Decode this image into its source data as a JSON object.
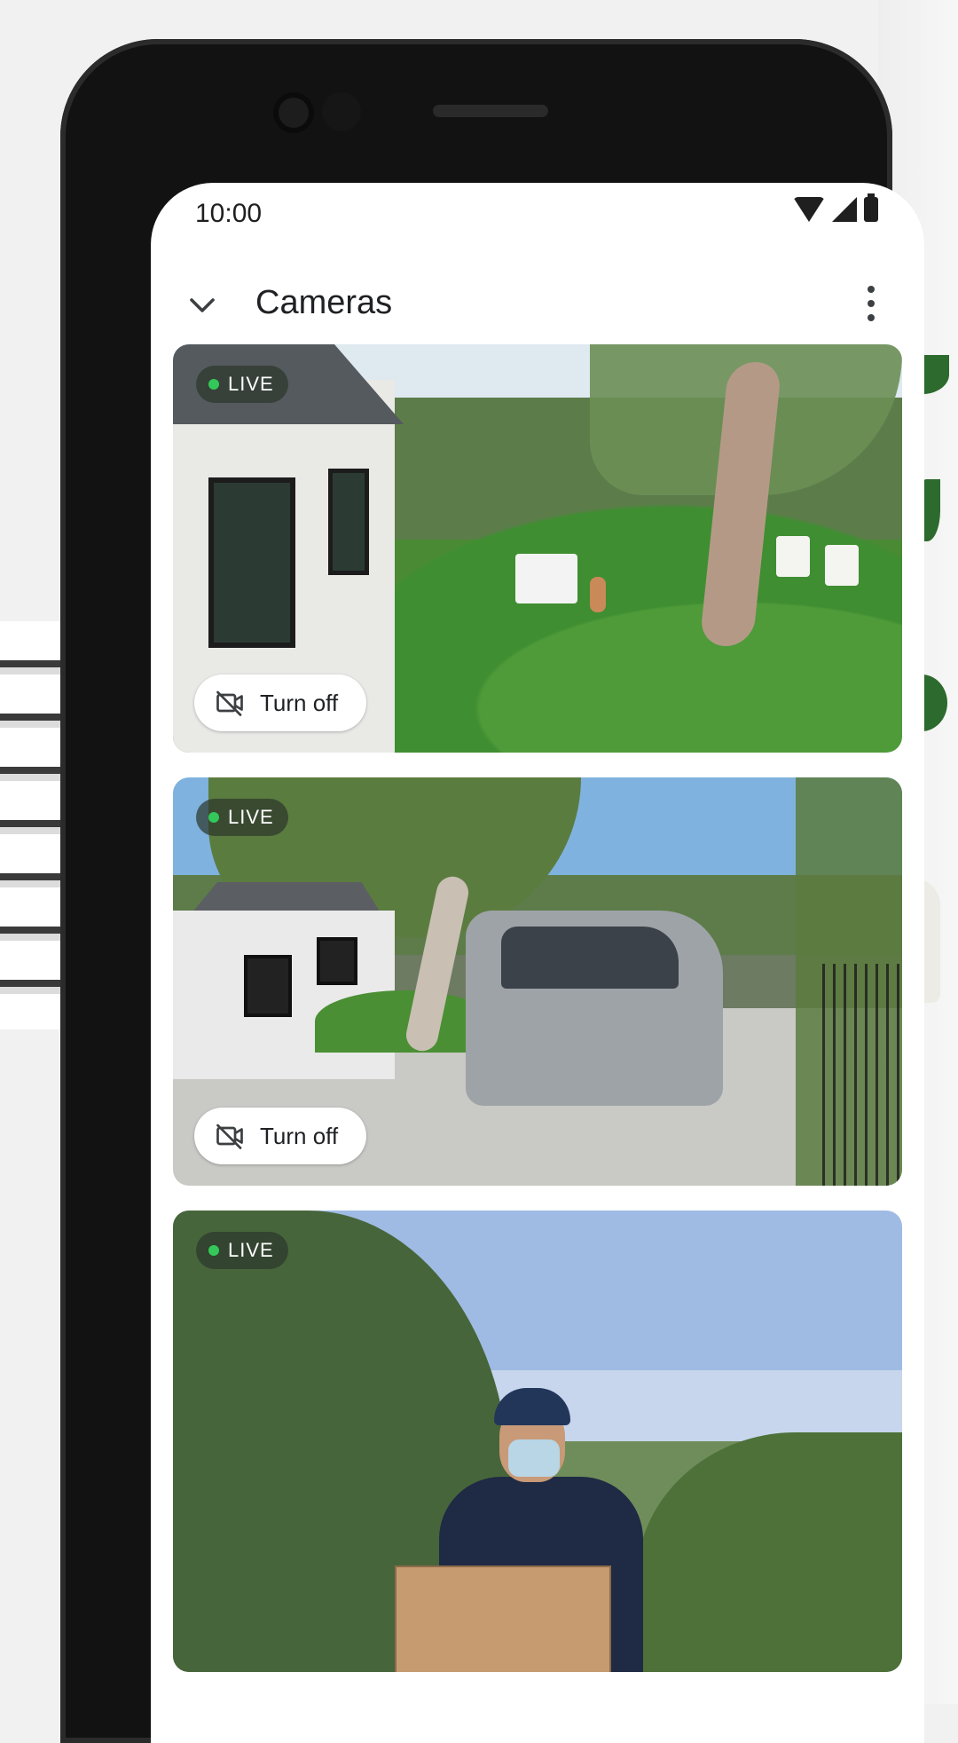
{
  "status_bar": {
    "time": "10:00"
  },
  "app_bar": {
    "title": "Cameras"
  },
  "cameras": [
    {
      "badge": "LIVE",
      "action_label": "Turn off"
    },
    {
      "badge": "LIVE",
      "action_label": "Turn off"
    },
    {
      "badge": "LIVE"
    }
  ],
  "icons": {
    "back": "chevron-down-icon",
    "more": "more-vert-icon",
    "camera_off": "videocam-off-icon",
    "wifi": "wifi-icon",
    "signal": "cell-signal-icon",
    "battery": "battery-icon"
  },
  "colors": {
    "live_dot": "#34c759",
    "live_badge_bg": "rgba(45,55,45,0.72)"
  }
}
